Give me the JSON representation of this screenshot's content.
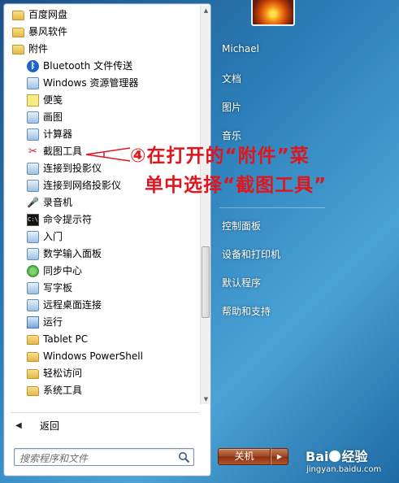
{
  "start_menu": {
    "programs": [
      {
        "label": "百度网盘",
        "icon": "folder-icon",
        "level": 0
      },
      {
        "label": "暴风软件",
        "icon": "folder-icon",
        "level": 0
      },
      {
        "label": "附件",
        "icon": "folder-icon",
        "level": 0
      },
      {
        "label": "Bluetooth 文件传送",
        "icon": "bluetooth-icon",
        "level": 1
      },
      {
        "label": "Windows 资源管理器",
        "icon": "explorer-icon",
        "level": 1
      },
      {
        "label": "便笺",
        "icon": "sticky-note-icon",
        "level": 1
      },
      {
        "label": "画图",
        "icon": "paint-icon",
        "level": 1
      },
      {
        "label": "计算器",
        "icon": "calculator-icon",
        "level": 1
      },
      {
        "label": "截图工具",
        "icon": "snipping-tool-icon",
        "level": 1
      },
      {
        "label": "连接到投影仪",
        "icon": "projector-icon",
        "level": 1
      },
      {
        "label": "连接到网络投影仪",
        "icon": "network-projector-icon",
        "level": 1
      },
      {
        "label": "录音机",
        "icon": "microphone-icon",
        "level": 1
      },
      {
        "label": "命令提示符",
        "icon": "cmd-icon",
        "level": 1
      },
      {
        "label": "入门",
        "icon": "getting-started-icon",
        "level": 1
      },
      {
        "label": "数学输入面板",
        "icon": "math-input-icon",
        "level": 1
      },
      {
        "label": "同步中心",
        "icon": "sync-icon",
        "level": 1
      },
      {
        "label": "写字板",
        "icon": "wordpad-icon",
        "level": 1
      },
      {
        "label": "远程桌面连接",
        "icon": "remote-desktop-icon",
        "level": 1
      },
      {
        "label": "运行",
        "icon": "run-icon",
        "level": 1
      },
      {
        "label": "Tablet PC",
        "icon": "folder-icon",
        "level": 1
      },
      {
        "label": "Windows PowerShell",
        "icon": "folder-icon",
        "level": 1
      },
      {
        "label": "轻松访问",
        "icon": "folder-icon",
        "level": 1
      },
      {
        "label": "系统工具",
        "icon": "folder-icon",
        "level": 1
      }
    ],
    "back_label": "返回",
    "search_placeholder": "搜索程序和文件",
    "user_name": "Michael",
    "right_links_top": [
      "文档",
      "图片",
      "音乐"
    ],
    "right_links_bottom": [
      "控制面板",
      "设备和打印机",
      "默认程序",
      "帮助和支持"
    ],
    "shutdown_label": "关机"
  },
  "annotation": {
    "line1": "④在打开的“附件”菜",
    "line2": "单中选择“截图工具”",
    "color": "#e0161e"
  },
  "watermark": {
    "brand": "Bai",
    "brand_suffix": "经验",
    "url": "jingyan.baidu.com"
  }
}
